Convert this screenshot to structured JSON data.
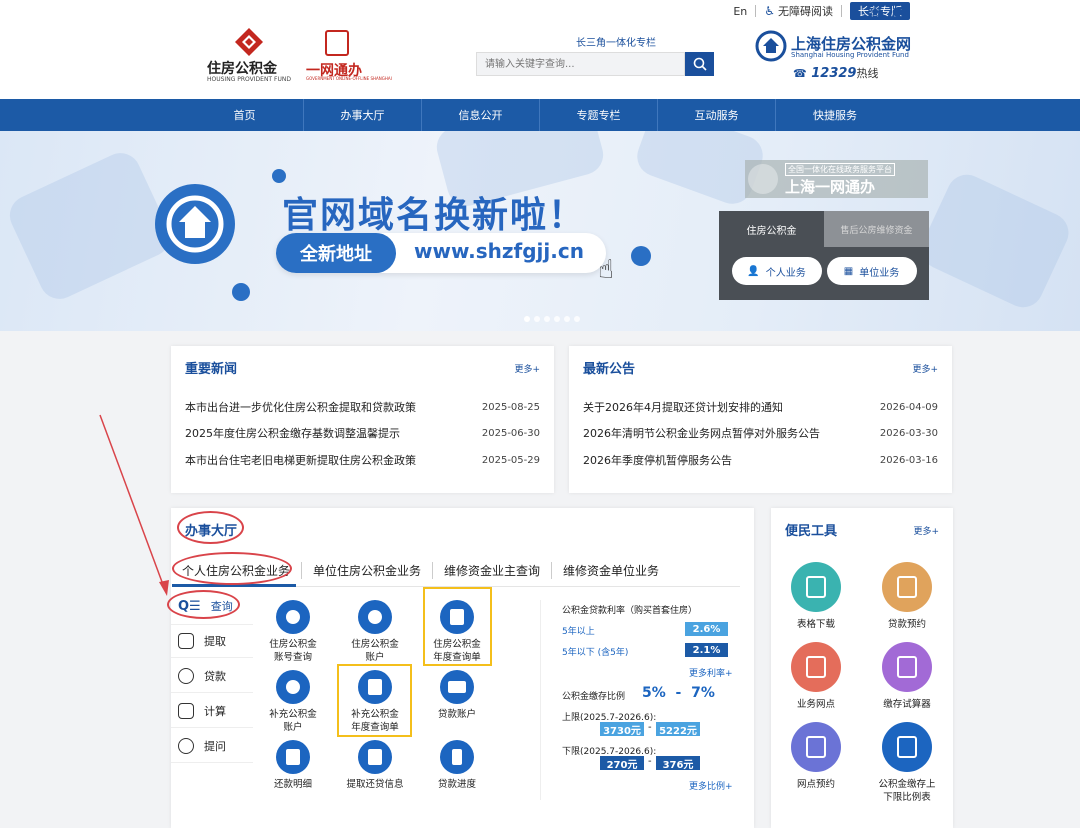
{
  "header": {
    "lang": "En",
    "accessibility": "无障碍阅读",
    "elder_mode": "长者专版",
    "logo1_title": "住房公积金",
    "logo1_sub": "HOUSING PROVIDENT FUND",
    "logo2_title": "一网通办",
    "logo2_sub": "GOVERNMENT ONLINE-OFFLINE SHANGHAI",
    "delta_link": "长三角一体化专栏",
    "search_placeholder": "请输入关键字查询...",
    "brand_cn": "上海住房公积金网",
    "brand_en": "Shanghai Housing Provident Fund",
    "hotline_number": "12329",
    "hotline_label": "热线"
  },
  "nav": [
    "首页",
    "办事大厅",
    "信息公开",
    "专题专栏",
    "互动服务",
    "快捷服务"
  ],
  "banner": {
    "headline": "官网域名换新啦！",
    "pill_label": "全新地址",
    "url": "www.shzfgjj.cn",
    "badge_small": "全国一体化在线政务服务平台",
    "badge_big": "上海一网通办",
    "tab_active": "住房公积金",
    "tab_inactive": "售后公房维修资金",
    "btn_personal": "个人业务",
    "btn_unit": "单位业务"
  },
  "news": {
    "title": "重要新闻",
    "more": "更多+",
    "items": [
      {
        "text": "本市出台进一步优化住房公积金提取和贷款政策",
        "date": "2025-08-25"
      },
      {
        "text": "2025年度住房公积金缴存基数调整温馨提示",
        "date": "2025-06-30"
      },
      {
        "text": "本市出台住宅老旧电梯更新提取住房公积金政策",
        "date": "2025-05-29"
      }
    ]
  },
  "notices": {
    "title": "最新公告",
    "more": "更多+",
    "items": [
      {
        "text": "关于2026年4月提取还贷计划安排的通知",
        "date": "2026-04-09"
      },
      {
        "text": "2026年清明节公积金业务网点暂停对外服务公告",
        "date": "2026-03-30"
      },
      {
        "text": "2026年季度停机暂停服务公告",
        "date": "2026-03-16"
      }
    ]
  },
  "hall": {
    "title": "办事大厅",
    "tabs": [
      "个人住房公积金业务",
      "单位住房公积金业务",
      "维修资金业主查询",
      "维修资金单位业务"
    ],
    "side": [
      "查询",
      "提取",
      "贷款",
      "计算",
      "提问"
    ],
    "services": [
      {
        "l1": "住房公积金",
        "l2": "账号查询"
      },
      {
        "l1": "住房公积金",
        "l2": "账户"
      },
      {
        "l1": "住房公积金",
        "l2": "年度查询单"
      },
      {
        "l1": "补充公积金",
        "l2": "账户"
      },
      {
        "l1": "补充公积金",
        "l2": "年度查询单"
      },
      {
        "l1": "贷款账户",
        "l2": ""
      },
      {
        "l1": "还款明细",
        "l2": ""
      },
      {
        "l1": "提取还贷信息",
        "l2": ""
      },
      {
        "l1": "贷款进度",
        "l2": ""
      }
    ],
    "rates": {
      "title": "公积金贷款利率（购买首套住房）",
      "r1_label": "5年以上",
      "r1_value": "2.6%",
      "r2_label": "5年以下 (含5年)",
      "r2_value": "2.1%",
      "more_rates": "更多利率+",
      "ratio_label": "公积金缴存比例",
      "ratio_value": "5%  -  7%",
      "upper_label": "上限(2025.7-2026.6):",
      "upper_min": "3730元",
      "upper_max": "5222元",
      "lower_label": "下限(2025.7-2026.6):",
      "lower_min": "270元",
      "lower_max": "376元",
      "more_ratios": "更多比例+",
      "dash": "-"
    }
  },
  "tools": {
    "title": "便民工具",
    "more": "更多+",
    "items": [
      {
        "label": "表格下载",
        "color": "#3ab3b0"
      },
      {
        "label": "贷款预约",
        "color": "#e0a35c"
      },
      {
        "label": "业务网点",
        "color": "#e46d5b"
      },
      {
        "label": "缴存试算器",
        "color": "#a26ad6"
      },
      {
        "label": "网点预约",
        "color": "#6b73d6"
      },
      {
        "label": "公积金缴存上",
        "label2": "下限比例表",
        "color": "#1c65c0"
      }
    ]
  }
}
